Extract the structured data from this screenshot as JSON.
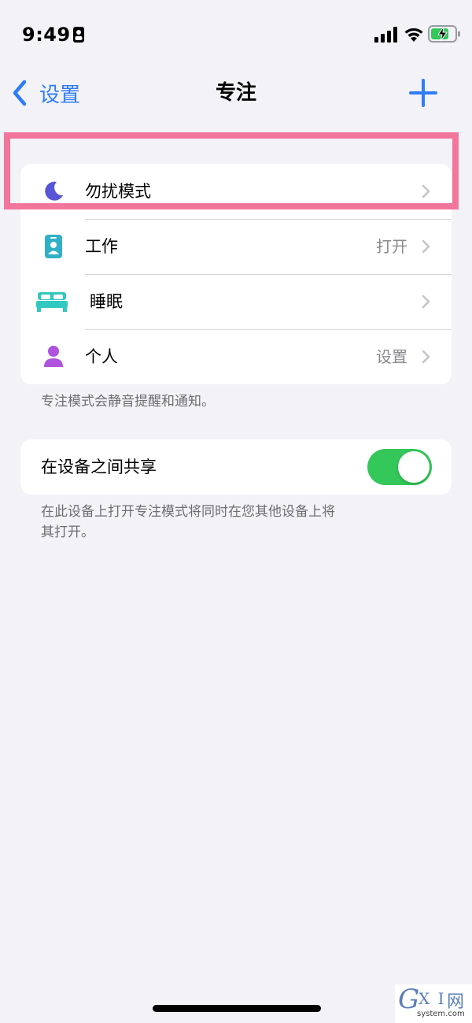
{
  "status_bar": {
    "time": "9:49"
  },
  "nav": {
    "back_label": "设置",
    "title": "专注"
  },
  "focus_list": {
    "items": [
      {
        "label": "勿扰模式",
        "value": ""
      },
      {
        "label": "工作",
        "value": "打开"
      },
      {
        "label": "睡眠",
        "value": ""
      },
      {
        "label": "个人",
        "value": "设置"
      }
    ],
    "footer": "专注模式会静音提醒和通知。"
  },
  "share": {
    "label": "在设备之间共享",
    "enabled": true,
    "footer_line1": "在此设备上打开专注模式将同时在您其他设备上将",
    "footer_line2": "其打开。"
  },
  "watermark": {
    "g": "G",
    "xi": "X I",
    "net": "网",
    "domain": "system.com"
  },
  "colors": {
    "accent": "#2f7cf6",
    "moon": "#5856d6",
    "work": "#30b0c7",
    "sleep": "#30c8c0",
    "personal": "#af52de",
    "toggle_on": "#34c759",
    "highlight": "#f2769c"
  }
}
